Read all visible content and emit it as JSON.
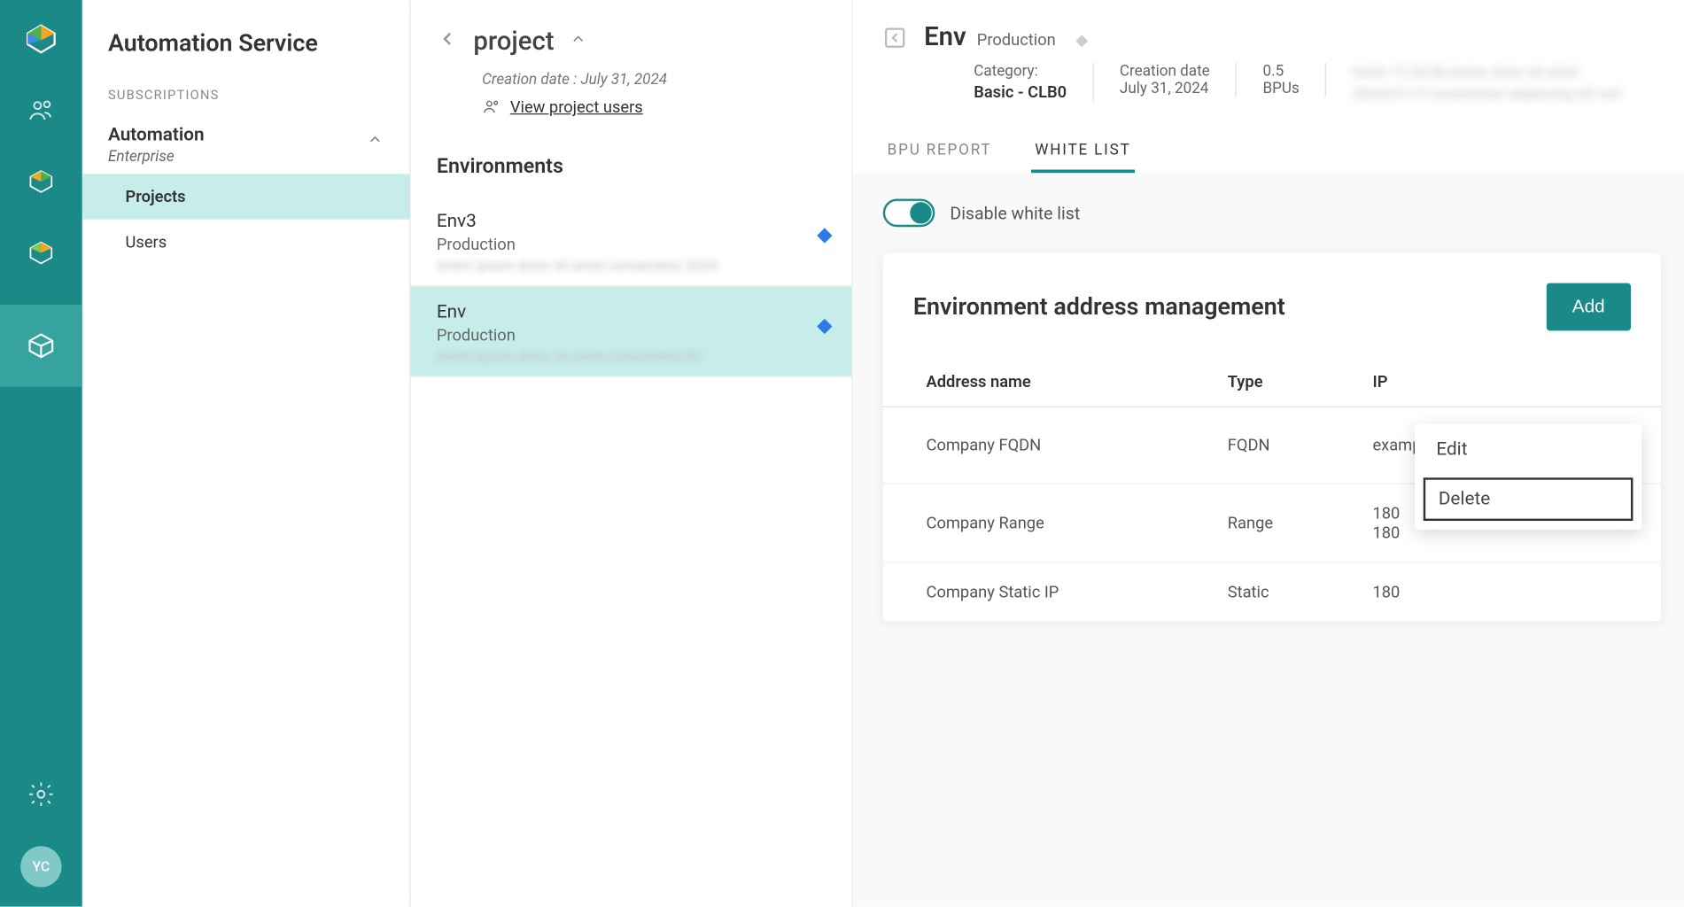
{
  "sidebar": {
    "title": "Automation Service",
    "section_label": "SUBSCRIPTIONS",
    "subscription": {
      "name": "Automation",
      "tier": "Enterprise"
    },
    "nav": {
      "projects": "Projects",
      "users": "Users"
    }
  },
  "avatar": "YC",
  "mid": {
    "title": "project",
    "creation_label": "Creation date : July 31, 2024",
    "view_users": "View project users",
    "env_section": "Environments",
    "envs": [
      {
        "name": "Env3",
        "tag": "Production",
        "blur": "lorem ipsum dolor sit amet consectetur 2024"
      },
      {
        "name": "Env",
        "tag": "Production",
        "blur": "lorem ipsum dolor sit amet consectetur 02"
      }
    ]
  },
  "main": {
    "title": "Env",
    "badge": "Production",
    "category_label": "Category:",
    "category_value": "Basic - CLB0",
    "creation_label": "Creation date",
    "creation_value": "July 31, 2024",
    "bpu_value": "0.5",
    "bpu_label": "BPUs",
    "blur": "lorem 12.34.56 ipsum dolor sit amet 2024/07/12 consectetur adipiscing elit sed",
    "tabs": {
      "bpu": "BPU REPORT",
      "white": "WHITE LIST"
    },
    "toggle_label": "Disable white list",
    "card_title": "Environment address management",
    "add_label": "Add",
    "cols": {
      "name": "Address name",
      "type": "Type",
      "ip": "IP"
    },
    "rows": [
      {
        "name": "Company FQDN",
        "type": "FQDN",
        "ip": "example.com"
      },
      {
        "name": "Company Range",
        "type": "Range",
        "ip": "180\n180"
      },
      {
        "name": "Company Static IP",
        "type": "Static",
        "ip": "180"
      }
    ],
    "popup": {
      "edit": "Edit",
      "delete": "Delete"
    }
  }
}
